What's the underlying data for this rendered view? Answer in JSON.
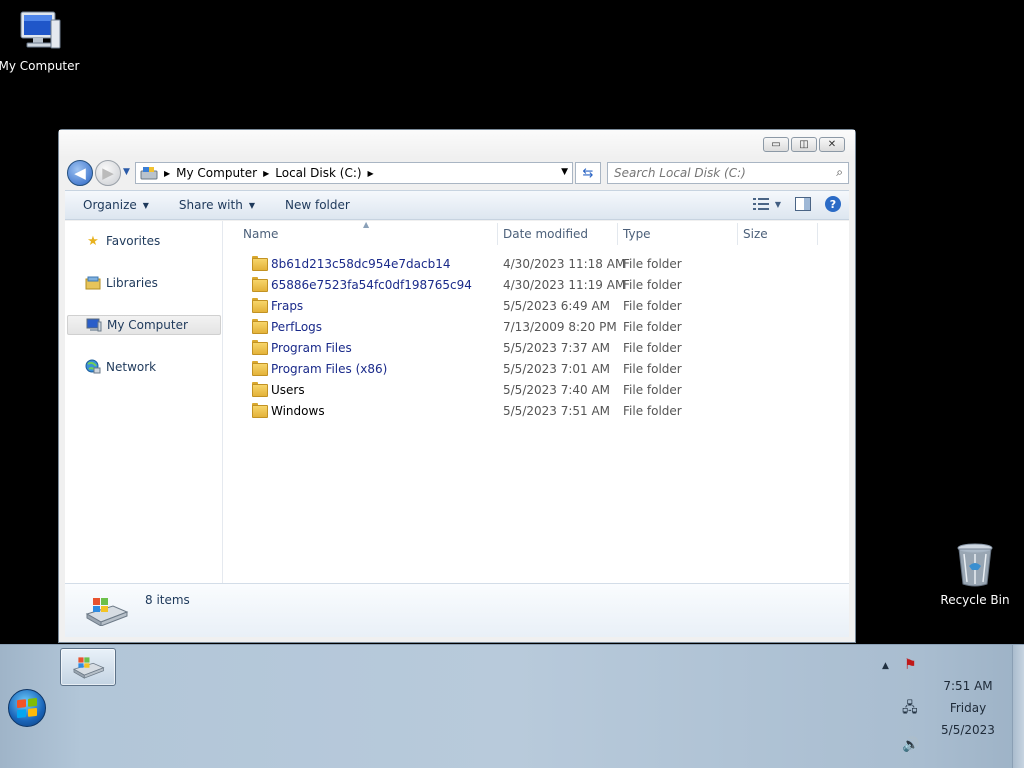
{
  "desktop": {
    "icons": [
      {
        "label": "My Computer"
      },
      {
        "label": "Recycle Bin"
      }
    ]
  },
  "window": {
    "controls": {
      "minimize": "▭",
      "restore": "◫",
      "close": "✕"
    },
    "nav": {
      "back": "◀",
      "forward": "▶"
    },
    "address": {
      "crumbs": [
        "My Computer",
        "Local Disk (C:)"
      ]
    },
    "search": {
      "placeholder": "Search Local Disk (C:)"
    },
    "toolbar": {
      "organize": "Organize",
      "share_with": "Share with",
      "new_folder": "New folder"
    },
    "navpane": {
      "items": [
        "Favorites",
        "Libraries",
        "My Computer",
        "Network"
      ]
    },
    "columns": {
      "name": "Name",
      "date": "Date modified",
      "type": "Type",
      "size": "Size"
    },
    "files": [
      {
        "name": "8b61d213c58dc954e7dacb14",
        "date": "4/30/2023 11:18 AM",
        "type": "File folder"
      },
      {
        "name": "65886e7523fa54fc0df198765c94",
        "date": "4/30/2023 11:19 AM",
        "type": "File folder"
      },
      {
        "name": "Fraps",
        "date": "5/5/2023 6:49 AM",
        "type": "File folder"
      },
      {
        "name": "PerfLogs",
        "date": "7/13/2009 8:20 PM",
        "type": "File folder"
      },
      {
        "name": "Program Files",
        "date": "5/5/2023 7:37 AM",
        "type": "File folder"
      },
      {
        "name": "Program Files (x86)",
        "date": "5/5/2023 7:01 AM",
        "type": "File folder"
      },
      {
        "name": "Users",
        "date": "5/5/2023 7:40 AM",
        "type": "File folder"
      },
      {
        "name": "Windows",
        "date": "5/5/2023 7:51 AM",
        "type": "File folder"
      }
    ],
    "status": {
      "items_count": "8 items"
    }
  },
  "taskbar": {
    "clock": {
      "time": "7:51 AM",
      "day": "Friday",
      "date": "5/5/2023"
    }
  },
  "colors": {
    "accent": "#2a64c4",
    "link": "#1a2a8a",
    "taskbar": "#b8cadb"
  }
}
